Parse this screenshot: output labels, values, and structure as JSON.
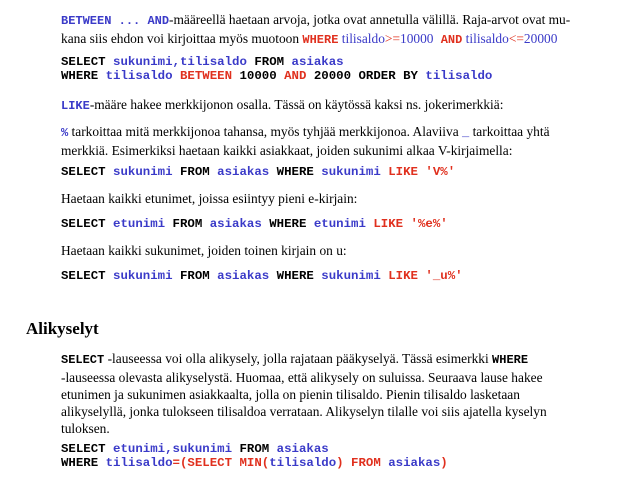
{
  "colors": {
    "identifier": "#3a3ac8",
    "operator": "#e0301e",
    "keyword": "#000000"
  },
  "para1": {
    "kw1": "BETWEEN",
    "dots": " ... ",
    "kw2": "AND",
    "text1": "-määreellä haetaan arvoja, jotka ovat annetulla välillä. Raja-arvot ovat mu-",
    "text2": "kana siis ehdon voi kirjoittaa myös muotoon ",
    "c1": "WHERE",
    "c2": " tilisaldo",
    "c3": ">=",
    "c4": "10000",
    "c5": " AND",
    "c6": " tilisaldo",
    "c7": "<=",
    "c8": "20000"
  },
  "code1": {
    "l1_kw": "SELECT",
    "l1_cols": " sukunimi,tilisaldo",
    "l1_from": " FROM",
    "l1_tbl": " asiakas",
    "l2_where": "WHERE",
    "l2_col": " tilisaldo",
    "l2_between": " BETWEEN",
    "l2_v1": " 10000",
    "l2_and": " AND",
    "l2_v2": " 20000",
    "l2_order": " ORDER BY",
    "l2_ocol": " tilisaldo"
  },
  "para2": {
    "kw": "LIKE",
    "text": "-määre hakee merkkijonon osalla. Tässä on käytössä kaksi ns. jokerimerkkiä:"
  },
  "para3": {
    "pct": "%",
    "text1": " tarkoittaa mitä merkkijonoa tahansa, myös tyhjää merkkijonoa. Alaviiva ",
    "us": "_",
    "text2": " tarkoittaa yhtä",
    "line2": "merkkiä. Esimerkiksi haetaan kaikki asiakkaat, joiden sukunimi alkaa V-kirjaimella:"
  },
  "code2": {
    "select": "SELECT",
    "col": " sukunimi",
    "from": " FROM",
    "tbl": " asiakas",
    "where": " WHERE",
    "wcol": " sukunimi",
    "like": " LIKE",
    "pat": " 'V%'"
  },
  "para4": {
    "text": "Haetaan kaikki etunimet, joissa esiintyy pieni e-kirjain:"
  },
  "code3": {
    "select": "SELECT",
    "col": " etunimi",
    "from": " FROM",
    "tbl": " asiakas",
    "where": " WHERE",
    "wcol": " etunimi",
    "like": " LIKE",
    "pat": " '%e%'"
  },
  "para5": {
    "text": "Haetaan kaikki sukunimet, joiden toinen kirjain on u:"
  },
  "code4": {
    "select": "SELECT",
    "col": " sukunimi",
    "from": " FROM",
    "tbl": " asiakas",
    "where": " WHERE",
    "wcol": " sukunimi",
    "like": " LIKE",
    "pat": " '_u%'"
  },
  "heading": "Alikyselyt",
  "para6": {
    "kw1": "SELECT",
    "t1": " -lauseessa voi olla alikysely, jolla rajataan pääkyselyä. Tässä esimerkki ",
    "kw2": "WHERE",
    "l2": "-lauseessa olevasta alikyselystä. Huomaa, että alikysely on suluissa. Seuraava lause hakee",
    "l3": "etunimen ja sukunimen asiakkaalta, jolla on pienin tilisaldo. Pienin tilisaldo lasketaan",
    "l4": "alikyselyllä, jonka tulokseen tilisaldoa verrataan. Alikyselyn tilalle voi siis ajatella kyselyn",
    "l5": "tuloksen."
  },
  "code5": {
    "l1_select": "SELECT",
    "l1_cols": " etunimi,sukunimi",
    "l1_from": " FROM",
    "l1_tbl": " asiakas",
    "l2_where": "WHERE",
    "l2_col": " tilisaldo",
    "l2_eq": "=(SELECT",
    "l2_min": " MIN(",
    "l2_mcol": "tilisaldo",
    "l2_close": ")",
    "l2_from": " FROM",
    "l2_tbl": " asiakas",
    "l2_end": ")"
  }
}
